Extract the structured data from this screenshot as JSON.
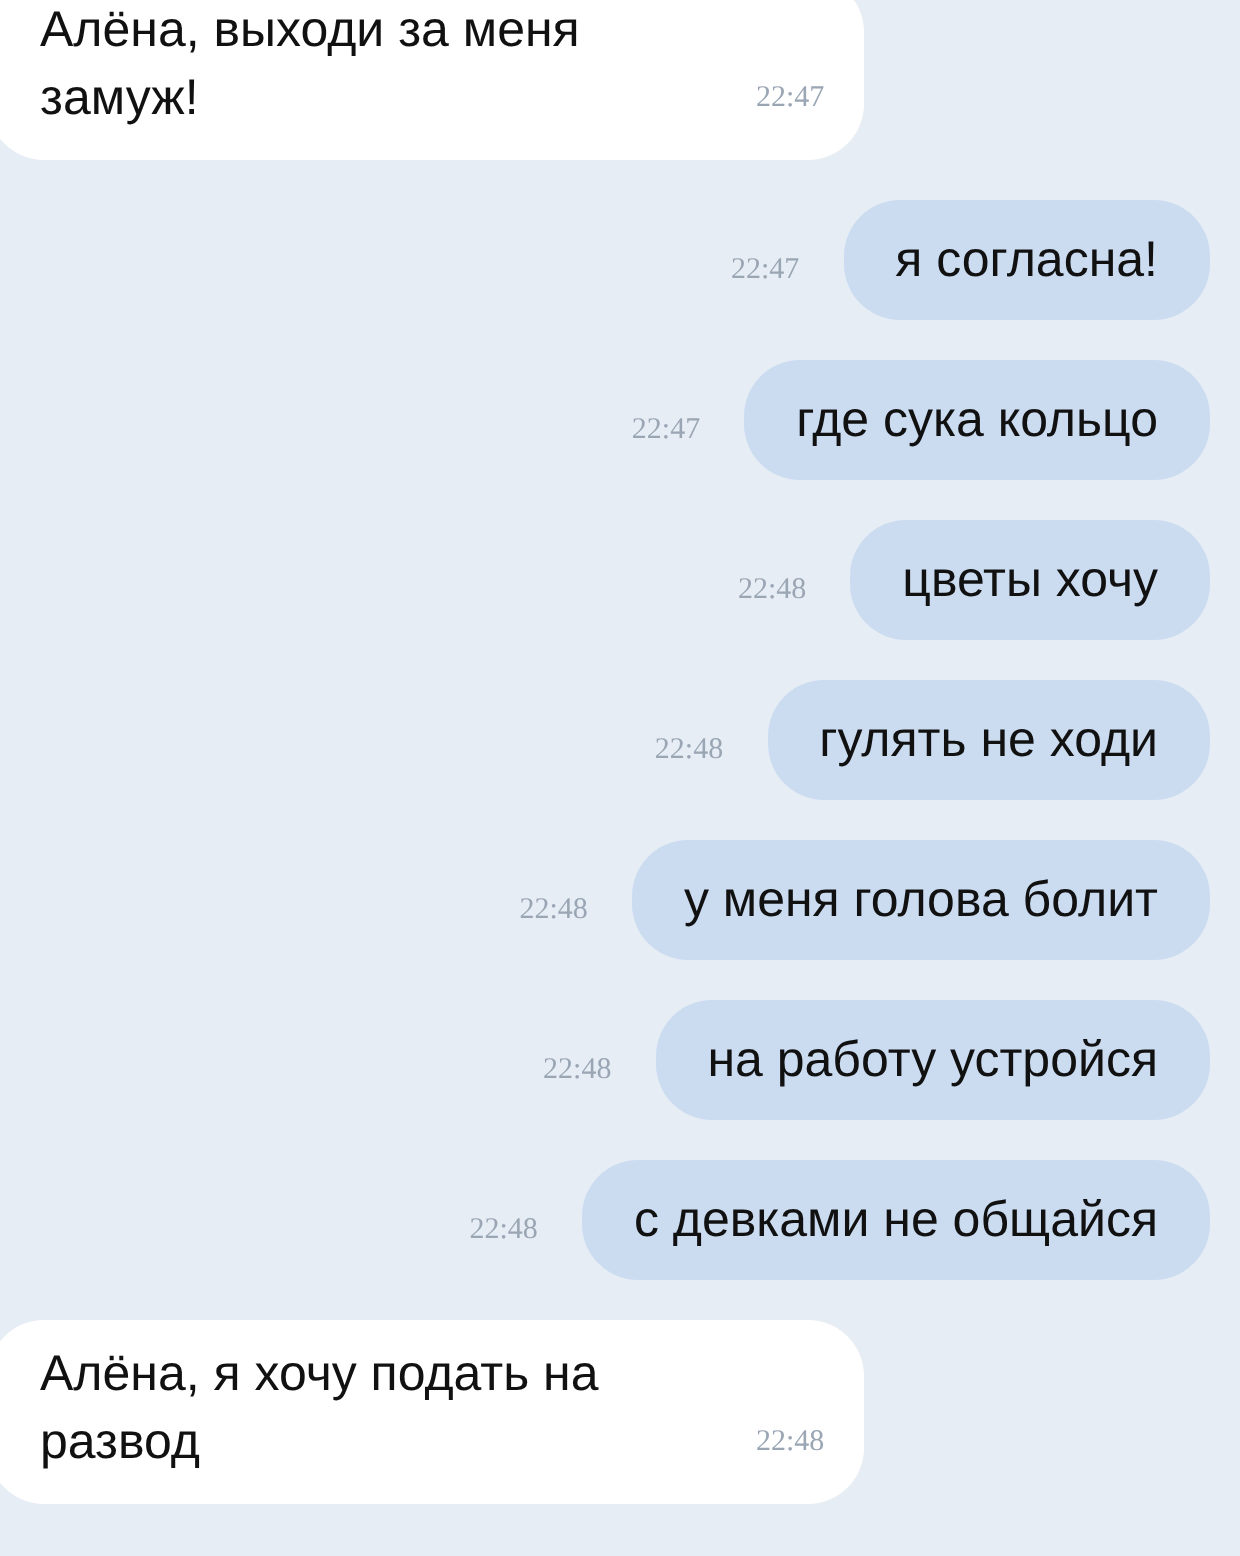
{
  "messages": [
    {
      "kind": "incoming",
      "text": "Алёна, выходи за меня замуж!",
      "time": "22:47"
    },
    {
      "kind": "outgoing",
      "text": "я согласна!",
      "time": "22:47"
    },
    {
      "kind": "outgoing",
      "text": "где сука кольцо",
      "time": "22:47"
    },
    {
      "kind": "outgoing",
      "text": "цветы хочу",
      "time": "22:48"
    },
    {
      "kind": "outgoing",
      "text": "гулять не ходи",
      "time": "22:48"
    },
    {
      "kind": "outgoing",
      "text": "у меня голова болит",
      "time": "22:48"
    },
    {
      "kind": "outgoing",
      "text": "на работу устройся",
      "time": "22:48"
    },
    {
      "kind": "outgoing",
      "text": "с девками не общайся",
      "time": "22:48"
    },
    {
      "kind": "incoming",
      "text": "Алёна, я хочу подать на развод",
      "time": "22:48"
    }
  ]
}
